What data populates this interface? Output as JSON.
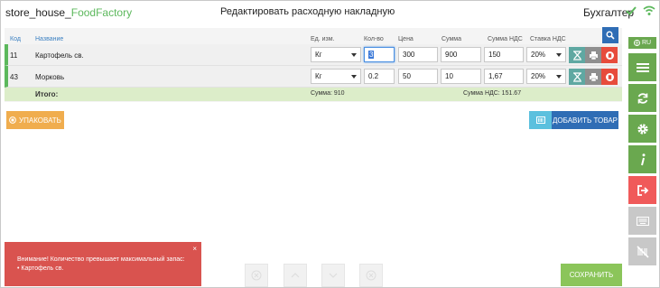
{
  "header": {
    "app_name": "store_house_",
    "app_name_accent": "FoodFactory",
    "page_title": "Редактировать расходную накладную",
    "user_role": "Бухгалтер"
  },
  "table": {
    "columns": [
      "Код",
      "Название",
      "Ед. изм.",
      "Кол-во",
      "Цена",
      "Сумма",
      "Сумма НДС",
      "Ставка НДС"
    ],
    "rows": [
      {
        "code": "11",
        "name": "Картофель св.",
        "unit": "Кг",
        "qty": "3",
        "price": "300",
        "sum": "900",
        "vat_sum": "150",
        "vat_rate": "20%"
      },
      {
        "code": "43",
        "name": "Морковь",
        "unit": "Кг",
        "qty": "0.2",
        "price": "50",
        "sum": "10",
        "vat_sum": "1,67",
        "vat_rate": "20%"
      }
    ],
    "totals": {
      "label": "Итого:",
      "sum_label": "Сумма: 910",
      "vat_label": "Сумма НДС: 151.67"
    }
  },
  "buttons": {
    "pack": "УПАКОВАТЬ",
    "add_item": "ДОБАВИТЬ ТОВАР",
    "save": "СОХРАНИТЬ"
  },
  "sidebar": {
    "language": "RU"
  },
  "alert": {
    "line1": "Внимание! Количество превышает максимальный запас:",
    "line2": "• Картофель св.",
    "close": "×"
  },
  "colors": {
    "green": "#5cb85c",
    "blue": "#2f6db5",
    "orange": "#f0ad4e",
    "red": "#e74c3c",
    "alert_red": "#d9534f"
  }
}
